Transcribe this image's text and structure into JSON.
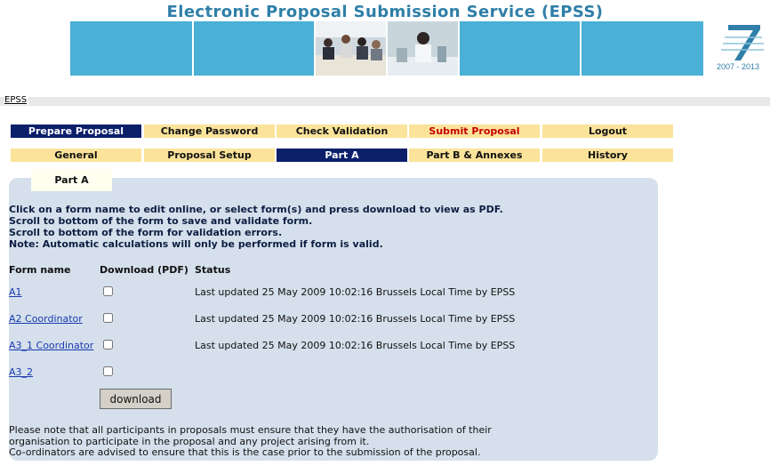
{
  "header": {
    "title": "Electronic Proposal Submission Service  (EPSS)",
    "logo_years": "2007 - 2013"
  },
  "breadcrumb": {
    "epss": "EPSS"
  },
  "nav_main": [
    {
      "label": "Prepare Proposal"
    },
    {
      "label": "Change Password"
    },
    {
      "label": "Check Validation"
    },
    {
      "label": "Submit Proposal"
    },
    {
      "label": "Logout"
    }
  ],
  "nav_sub": [
    {
      "label": "General"
    },
    {
      "label": "Proposal Setup"
    },
    {
      "label": "Part A"
    },
    {
      "label": "Part B & Annexes"
    },
    {
      "label": "History"
    }
  ],
  "section_tab": "Part A",
  "instructions": [
    "Click on a form name to edit online, or select form(s) and press download to view as PDF.",
    "Scroll to bottom of the form to save and validate form.",
    "Scroll to bottom of the form for validation errors.",
    "Note: Automatic calculations will only be performed if form is valid."
  ],
  "table": {
    "headers": [
      "Form name",
      "Download (PDF)",
      "Status"
    ],
    "rows": [
      {
        "name": "A1",
        "status": "Last updated 25 May 2009 10:02:16 Brussels Local Time by EPSS"
      },
      {
        "name": "A2 Coordinator",
        "status": "Last updated 25 May 2009 10:02:16 Brussels Local Time by EPSS"
      },
      {
        "name": "A3_1 Coordinator",
        "status": "Last updated 25 May 2009 10:02:16 Brussels Local Time by EPSS"
      },
      {
        "name": "A3_2",
        "status": ""
      }
    ]
  },
  "download_label": "download",
  "footer_note": [
    "Please note that all participants in proposals must ensure that they have the authorisation of their",
    "organisation to participate in the proposal and any project arising from it.",
    "Co-ordinators are advised to ensure that this is the case prior to the submission of the proposal."
  ],
  "colors": {
    "accent_title": "#2f7fa8",
    "nav_tab": "#fbe39a",
    "nav_active": "#0b1f6b",
    "panel": "#d5e0ec",
    "banner": "#4ab0d6"
  }
}
